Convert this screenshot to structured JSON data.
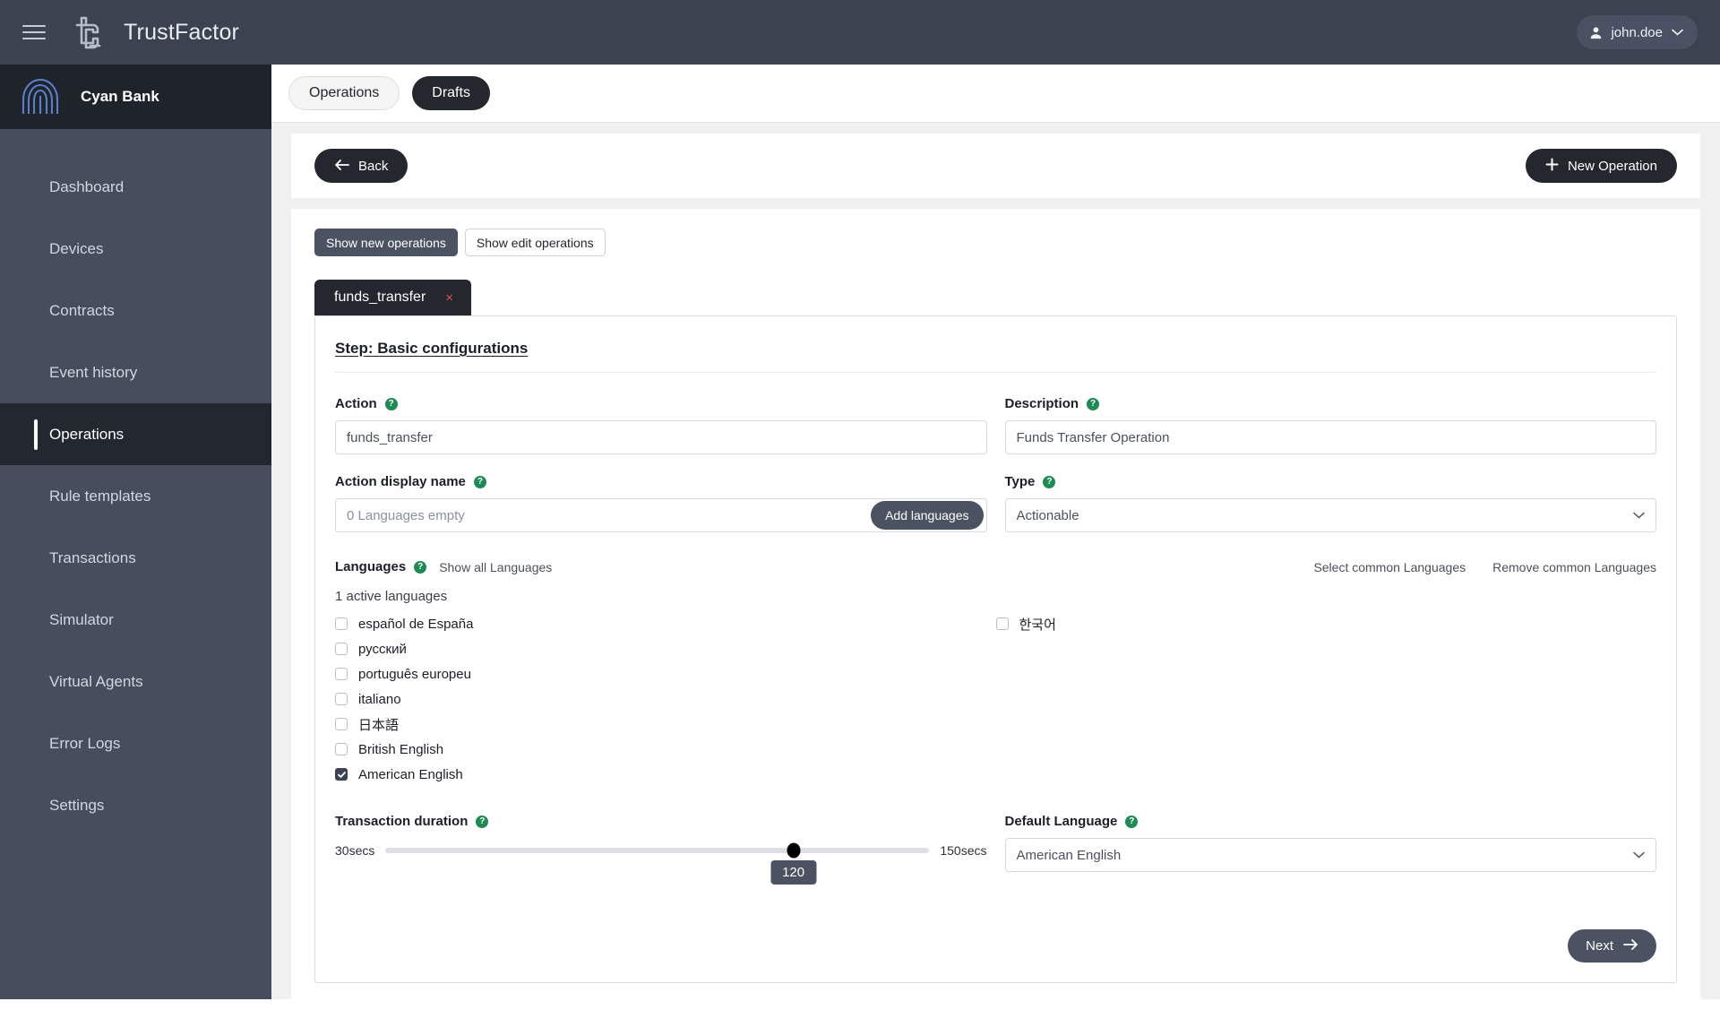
{
  "app": {
    "name": "TrustFactor",
    "user": "john.doe"
  },
  "org": {
    "name": "Cyan Bank"
  },
  "sidebar": {
    "items": [
      {
        "label": "Dashboard",
        "active": false
      },
      {
        "label": "Devices",
        "active": false
      },
      {
        "label": "Contracts",
        "active": false
      },
      {
        "label": "Event history",
        "active": false
      },
      {
        "label": "Operations",
        "active": true
      },
      {
        "label": "Rule templates",
        "active": false
      },
      {
        "label": "Transactions",
        "active": false
      },
      {
        "label": "Simulator",
        "active": false
      },
      {
        "label": "Virtual Agents",
        "active": false
      },
      {
        "label": "Error Logs",
        "active": false
      },
      {
        "label": "Settings",
        "active": false
      }
    ]
  },
  "tabs": [
    {
      "label": "Operations",
      "selected": false
    },
    {
      "label": "Drafts",
      "selected": true
    }
  ],
  "toolbar": {
    "back_label": "Back",
    "new_operation_label": "New Operation"
  },
  "filters": {
    "show_new_label": "Show new operations",
    "show_edit_label": "Show edit operations"
  },
  "doc_tab": {
    "label": "funds_transfer",
    "close_glyph": "×"
  },
  "form": {
    "step_title": "Step: Basic configurations",
    "action": {
      "label": "Action",
      "value": "funds_transfer",
      "placeholder": "funds_transfer"
    },
    "description": {
      "label": "Description",
      "value": "Funds Transfer Operation",
      "placeholder": "Funds Transfer Operation"
    },
    "action_display_name": {
      "label": "Action display name",
      "placeholder": "0 Languages empty",
      "value": "",
      "button_label": "Add languages"
    },
    "type": {
      "label": "Type",
      "value": "Actionable",
      "options": [
        "Actionable"
      ]
    },
    "languages": {
      "label": "Languages",
      "show_all_label": "Show all Languages",
      "select_common_label": "Select common Languages",
      "remove_common_label": "Remove common Languages",
      "active_count_text": "1 active languages",
      "column_left": [
        {
          "label": "español de España",
          "checked": false
        },
        {
          "label": "русский",
          "checked": false
        },
        {
          "label": "português europeu",
          "checked": false
        },
        {
          "label": "italiano",
          "checked": false
        },
        {
          "label": "日本語",
          "checked": false
        },
        {
          "label": "British English",
          "checked": false
        },
        {
          "label": "American English",
          "checked": true
        }
      ],
      "column_right": [
        {
          "label": "한국어",
          "checked": false
        }
      ]
    },
    "transaction_duration": {
      "label": "Transaction duration",
      "min_label": "30secs",
      "max_label": "150secs",
      "min": 30,
      "max": 150,
      "value": 120,
      "value_label": "120"
    },
    "default_language": {
      "label": "Default Language",
      "value": "American English",
      "options": [
        "American English"
      ]
    },
    "next_label": "Next"
  },
  "colors": {
    "topbar": "#3b4250",
    "sidebar": "#464d5c",
    "sidebar_active": "#23272f",
    "accent_dark": "#24272e",
    "slate": "#4b5261",
    "help_green": "#1f8a55",
    "close_red": "#e05252"
  }
}
